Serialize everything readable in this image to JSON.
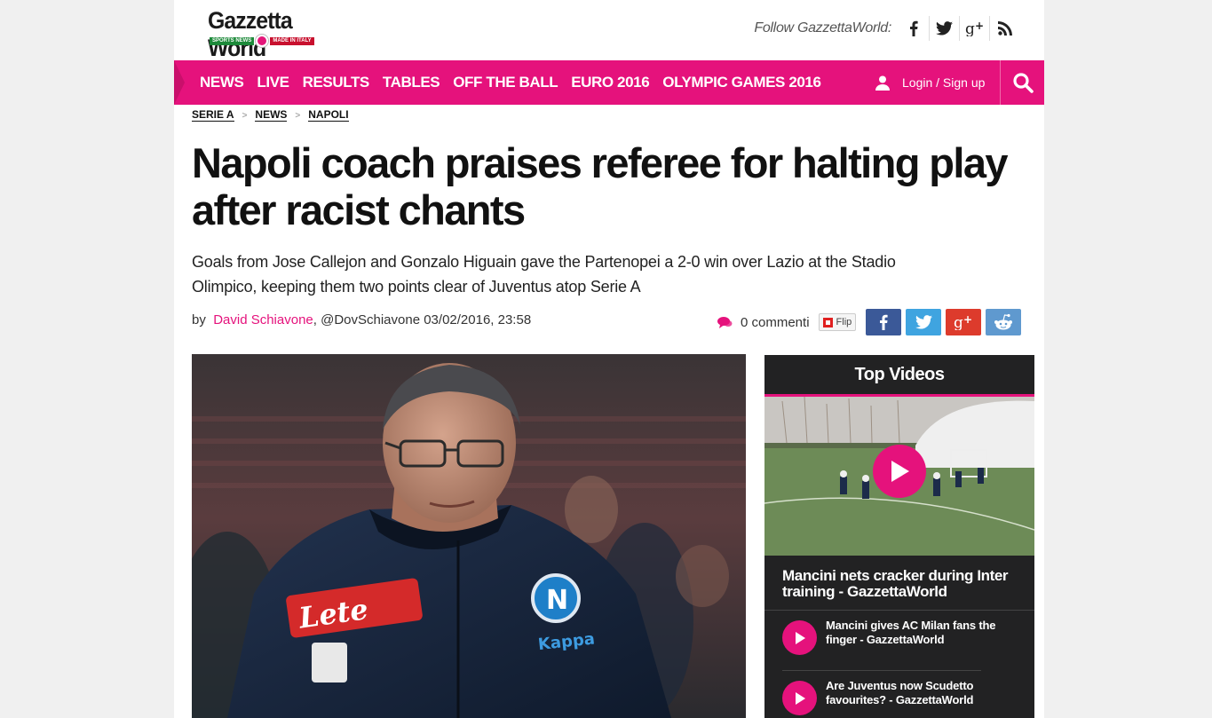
{
  "header": {
    "logo_name": "Gazzetta World",
    "logo_left": "SPORTS NEWS",
    "logo_right": "MADE IN ITALY",
    "follow_text": "Follow GazzettaWorld:",
    "social_icons": [
      "facebook-icon",
      "twitter-icon",
      "google-plus-icon",
      "rss-icon"
    ]
  },
  "nav": {
    "items": [
      "NEWS",
      "LIVE",
      "RESULTS",
      "TABLES",
      "OFF THE BALL",
      "EURO 2016",
      "OLYMPIC GAMES 2016"
    ],
    "login_label": "Login / Sign up",
    "accent_color": "#e5127c"
  },
  "breadcrumb": [
    "SERIE A",
    "NEWS",
    "NAPOLI"
  ],
  "article": {
    "title": "Napoli coach praises referee for halting play after racist chants",
    "subtitle": "Goals from Jose Callejon and Gonzalo Higuain gave the Partenopei a 2-0 win over Lazio at the Stadio Olimpico, keeping them two points clear of Juventus atop Serie A",
    "by_label": "by",
    "author": "David Schiavone",
    "handle_date": ", @DovSchiavone 03/02/2016, 23:58",
    "comments": "0 commenti",
    "flip_label": "Flip"
  },
  "hero": {
    "kit_sponsor": "Lete",
    "kit_brand": "Kappa",
    "badge_letter": "N"
  },
  "sidebar": {
    "heading": "Top Videos",
    "main_title": "Mancini nets cracker during Inter training - GazzettaWorld",
    "items": [
      {
        "title": "Mancini gives AC Milan fans the finger - GazzettaWorld"
      },
      {
        "title": "Are Juventus now Scudetto favourites? - GazzettaWorld"
      }
    ]
  }
}
